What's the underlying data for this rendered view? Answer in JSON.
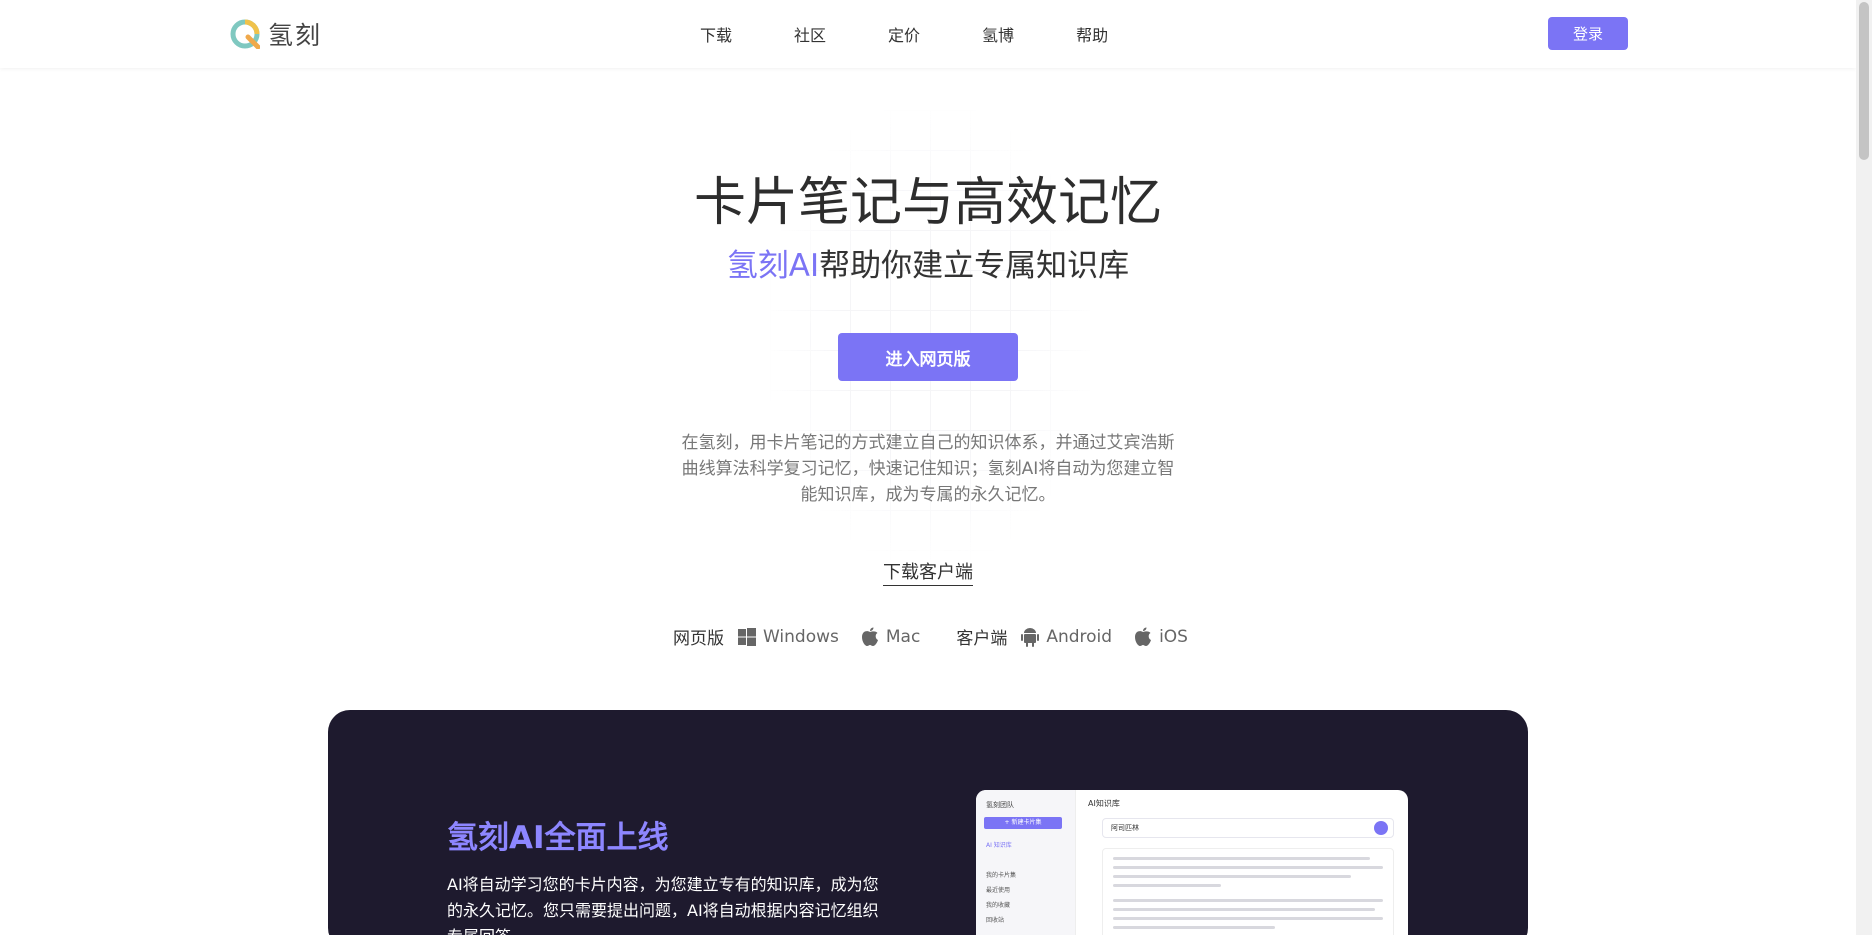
{
  "header": {
    "logo_text": "氢刻",
    "nav": [
      "下载",
      "社区",
      "定价",
      "氢博",
      "帮助"
    ],
    "login_label": "登录"
  },
  "hero": {
    "title": "卡片笔记与高效记忆",
    "subtitle_accent": "氢刻AI",
    "subtitle_rest": "帮助你建立专属知识库",
    "cta_label": "进入网页版",
    "description": "在氢刻，用卡片笔记的方式建立自己的知识体系，并通过艾宾浩斯曲线算法科学复习记忆，快速记住知识；氢刻AI将自动为您建立智能知识库，成为专属的永久记忆。",
    "download_link": "下载客户端"
  },
  "platforms": {
    "web_label": "网页版",
    "web_items": [
      {
        "label": "Windows",
        "icon": "windows-icon"
      },
      {
        "label": "Mac",
        "icon": "apple-icon"
      }
    ],
    "client_label": "客户端",
    "client_items": [
      {
        "label": "Android",
        "icon": "android-icon"
      },
      {
        "label": "iOS",
        "icon": "apple-icon"
      }
    ]
  },
  "ai_section": {
    "title": "氢刻AI全面上线",
    "description": "AI将自动学习您的卡片内容，为您建立专有的知识库，成为您的永久记忆。您只需要提出问题，AI将自动根据内容记忆组织专属回答。",
    "mock": {
      "sidebar_head": "氢刻团队",
      "new_card": "+ 新建卡片集",
      "ai_item": "AI 知识库",
      "sidebar_items": [
        "我的卡片集",
        "最近使用",
        "我的收藏",
        "回收站"
      ],
      "main_title": "AI知识库",
      "query": "阿司匹林"
    }
  },
  "colors": {
    "accent": "#7b74f5",
    "dark_section": "#1e1a2e",
    "ai_title": "#8d86ff"
  }
}
